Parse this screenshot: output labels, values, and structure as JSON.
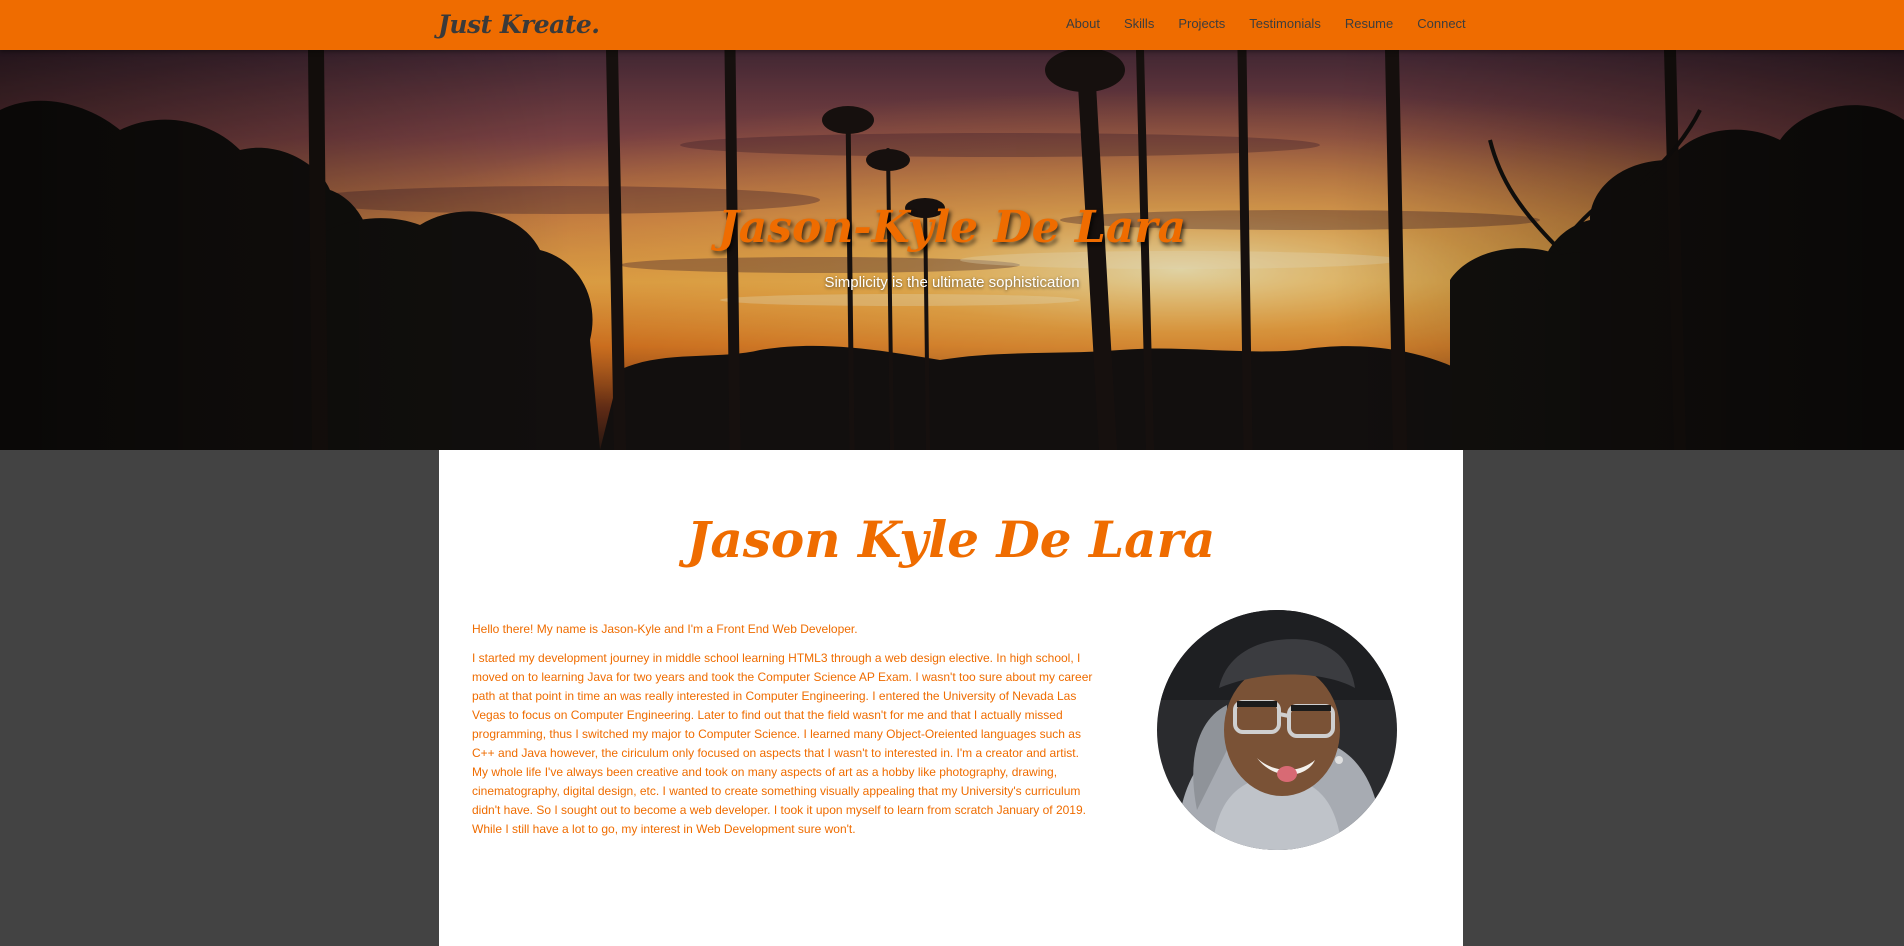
{
  "nav": {
    "brand": "Just Kreate.",
    "links": [
      "About",
      "Skills",
      "Projects",
      "Testimonials",
      "Resume",
      "Connect"
    ]
  },
  "hero": {
    "title": "Jason-Kyle De Lara",
    "subtitle": "Simplicity is the ultimate sophistication"
  },
  "about": {
    "heading": "Jason Kyle De Lara",
    "intro": "Hello there! My name is Jason-Kyle and I'm a Front End Web Developer.",
    "body": "I started my development journey in middle school learning HTML3 through a web design elective. In high school, I moved on to learning Java for two years and took the Computer Science AP Exam. I wasn't too sure about my career path at that point in time an was really interested in Computer Engineering. I entered the University of Nevada Las Vegas to focus on Computer Engineering. Later to find out that the field wasn't for me and that I actually missed programming, thus I switched my major to Computer Science. I learned many Object-Oreiented languages such as C++ and Java however, the ciriculum only focused on aspects that I wasn't to interested in. I'm a creator and artist. My whole life I've always been creative and took on many aspects of art as a hobby like photography, drawing, cinematography, digital design, etc. I wanted to create something visually appealing that my University's curriculum didn't have. So I sought out to become a web developer. I took it upon myself to learn from scratch January of 2019. While I still have a lot to go, my interest in Web Development sure won't."
  },
  "colors": {
    "accent": "#ef6c00",
    "page_background": "#434343",
    "card_background": "#ffffff",
    "nav_text": "#3d3d3d"
  },
  "icons": {
    "hero_image": "sunset-palm-trees-photo",
    "avatar": "profile-photo"
  }
}
